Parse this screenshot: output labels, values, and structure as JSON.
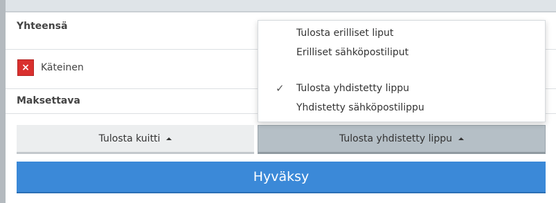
{
  "summary": {
    "total_label": "Yhteensä",
    "payable_label": "Maksettava"
  },
  "payment": {
    "method_label": "Käteinen",
    "remove_icon": "close-icon",
    "remove_symbol": "×",
    "remove_color": "#d9302e"
  },
  "buttons": {
    "print_receipt": "Tulosta kuitti",
    "print_ticket": "Tulosta yhdistetty lippu",
    "accept": "Hyväksy",
    "accept_color": "#3b89d8",
    "caret_icon": "caret-up-icon"
  },
  "ticket_menu": {
    "check_symbol": "✓",
    "items": [
      {
        "label": "Tulosta erilliset liput",
        "selected": false
      },
      {
        "label": "Erilliset sähköpostiliput",
        "selected": false
      },
      {
        "label": "Tulosta yhdistetty lippu",
        "selected": true
      },
      {
        "label": "Yhdistetty sähköpostilippu",
        "selected": false
      }
    ]
  }
}
